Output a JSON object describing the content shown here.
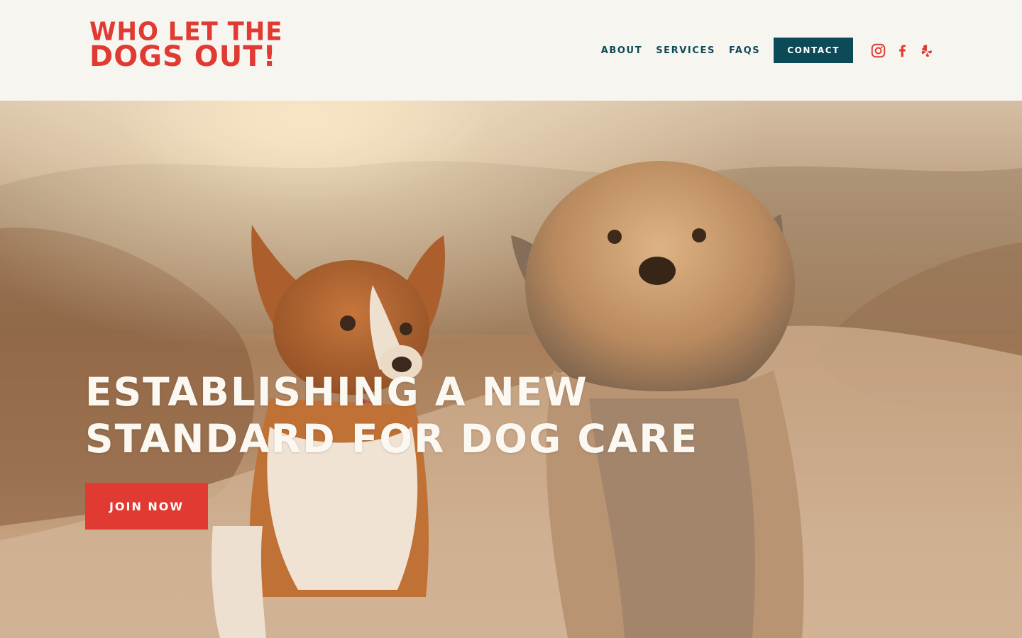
{
  "brand": {
    "line1": "WHO LET THE",
    "line2": "DOGS OUT!",
    "color": "#e03a32"
  },
  "nav": {
    "links": [
      {
        "label": "ABOUT"
      },
      {
        "label": "SERVICES"
      },
      {
        "label": "FAQS"
      }
    ],
    "contact_label": "CONTACT",
    "accent": "#0d4a57"
  },
  "social": [
    {
      "icon": "instagram-icon"
    },
    {
      "icon": "facebook-icon"
    },
    {
      "icon": "yelp-icon"
    }
  ],
  "hero": {
    "headline_line1": "ESTABLISHING A NEW",
    "headline_line2": "STANDARD FOR DOG CARE",
    "cta_label": "JOIN NOW",
    "cta_color": "#e03a32",
    "image": "two dogs running on a dirt path at sunset"
  }
}
